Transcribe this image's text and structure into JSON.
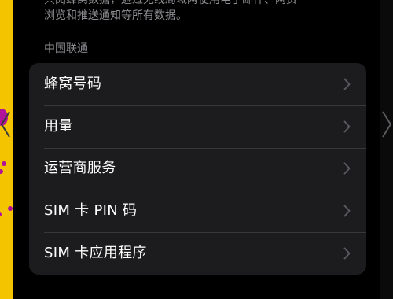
{
  "description": {
    "line1": "只阅蜂窝数据，避过无线局域网使用电子邮件、网页",
    "line2": "浏览和推送通知等所有数据。"
  },
  "carrier_section": {
    "header": "中国联通",
    "items": [
      {
        "label": "蜂窝号码",
        "icon": "chevron-right-icon"
      },
      {
        "label": "用量",
        "icon": "chevron-right-icon"
      },
      {
        "label": "运营商服务",
        "icon": "chevron-right-icon"
      },
      {
        "label": "SIM 卡 PIN 码",
        "icon": "chevron-right-icon"
      },
      {
        "label": "SIM 卡应用程序",
        "icon": "chevron-right-icon"
      }
    ]
  },
  "colors": {
    "background": "#000000",
    "group_background": "#1c1c1e",
    "separator": "#38383a",
    "primary_text": "#ffffff",
    "secondary_text": "#8e8e93",
    "chevron": "#5a5a5e",
    "wallpaper_yellow": "#f5c400",
    "wallpaper_magenta": "#b0129a"
  }
}
